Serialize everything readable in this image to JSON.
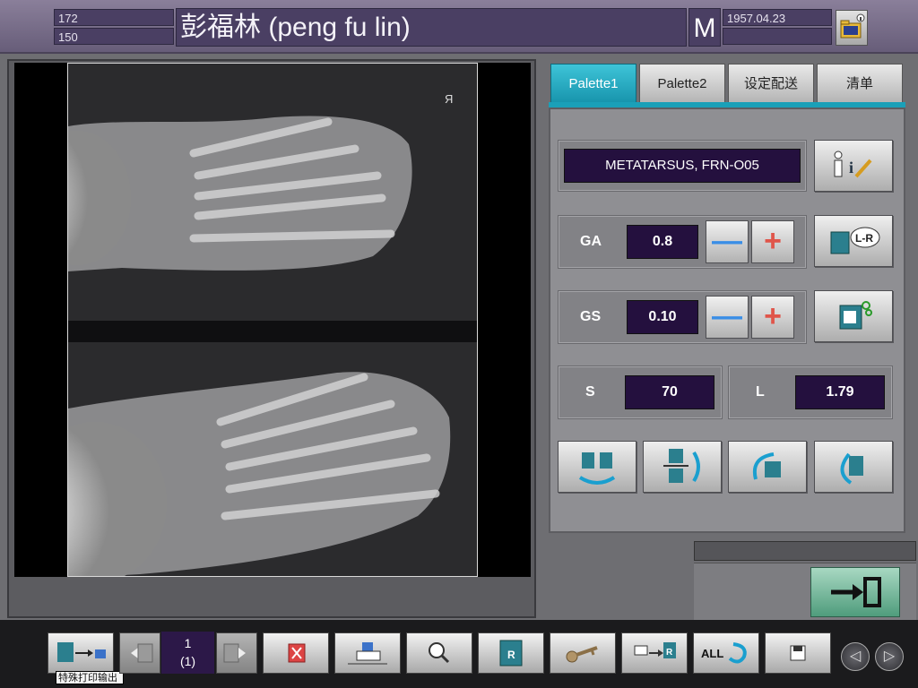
{
  "header": {
    "height_value": "172",
    "weight_value": "150",
    "patient_name": "彭福林 (peng fu lin)",
    "sex": "M",
    "birth_date": "1957.04.23",
    "extra_field": ""
  },
  "image": {
    "orientation_marker": "Я"
  },
  "tabs": [
    {
      "label": "Palette1",
      "active": true
    },
    {
      "label": "Palette2",
      "active": false
    },
    {
      "label": "设定配送",
      "active": false
    },
    {
      "label": "清单",
      "active": false
    }
  ],
  "controls": {
    "exam_name": "METATARSUS, FRN-O05",
    "ga": {
      "label": "GA",
      "value": "0.8"
    },
    "gs": {
      "label": "GS",
      "value": "0.10"
    },
    "s": {
      "label": "S",
      "value": "70"
    },
    "l": {
      "label": "L",
      "value": "1.79"
    },
    "minus_glyph": "—",
    "plus_glyph": "+"
  },
  "toolbar": {
    "page_current": "1",
    "page_total": "(1)",
    "tooltip": "特殊打印输出",
    "all_label": "ALL",
    "r_label": "R",
    "prev_glyph": "◁",
    "next_glyph": "▷"
  },
  "colors": {
    "accent_tab": "#1895ad",
    "value_bg": "#24103e",
    "header_bg": "#4a3f63",
    "exit_green": "#4f9c7c"
  }
}
